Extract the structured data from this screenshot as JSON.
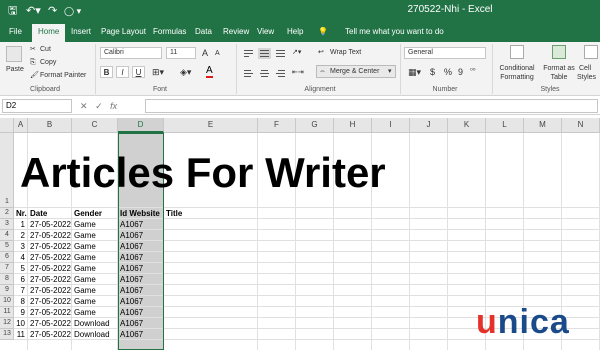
{
  "window": {
    "doc_title": "270522-Nhi  -  Excel"
  },
  "quick_access": {
    "save_icon": "save-icon",
    "undo_icon": "undo-icon",
    "redo_icon": "redo-icon"
  },
  "tabs": [
    "File",
    "Home",
    "Insert",
    "Page Layout",
    "Formulas",
    "Data",
    "Review",
    "View",
    "Help"
  ],
  "tell_me": "Tell me what you want to do",
  "ribbon": {
    "clipboard": {
      "paste": "Paste",
      "cut": "Cut",
      "copy": "Copy",
      "format_painter": "Format Painter",
      "label": "Clipboard"
    },
    "font": {
      "name": "Calibri",
      "size": "11",
      "grow": "A",
      "shrink": "A",
      "bold": "B",
      "italic": "I",
      "underline": "U",
      "font_color": "A",
      "label": "Font"
    },
    "alignment": {
      "wrap_text": "Wrap Text",
      "merge_center": "Merge & Center",
      "label": "Alignment"
    },
    "number": {
      "format": "General",
      "currency": "$",
      "percent": "%",
      "comma": "9",
      "label": "Number"
    },
    "styles": {
      "conditional_formatting": [
        "Conditional",
        "Formatting"
      ],
      "format_as_table": [
        "Format as",
        "Table"
      ],
      "cell_styles": [
        "Cell",
        "Styles"
      ],
      "label": "Styles"
    }
  },
  "formula_bar": {
    "name_box": "D2",
    "cancel": "✕",
    "enter": "✓",
    "fx": "fx",
    "value": ""
  },
  "columns": [
    "A",
    "B",
    "C",
    "D",
    "E",
    "F",
    "G",
    "H",
    "I",
    "J",
    "K",
    "L",
    "M",
    "N"
  ],
  "selected_column": "D",
  "rows": [
    "1",
    "2",
    "3",
    "4",
    "5",
    "6",
    "7",
    "8",
    "9",
    "10",
    "11",
    "12",
    "13"
  ],
  "sheet": {
    "title": "Articles For Writer",
    "headers": [
      "Nr.",
      "Date",
      "Gender",
      "Id Website",
      "Title"
    ],
    "data": [
      [
        "1",
        "27-05-2022",
        "Game",
        "A1067"
      ],
      [
        "2",
        "27-05-2022",
        "Game",
        "A1067"
      ],
      [
        "3",
        "27-05-2022",
        "Game",
        "A1067"
      ],
      [
        "4",
        "27-05-2022",
        "Game",
        "A1067"
      ],
      [
        "5",
        "27-05-2022",
        "Game",
        "A1067"
      ],
      [
        "6",
        "27-05-2022",
        "Game",
        "A1067"
      ],
      [
        "7",
        "27-05-2022",
        "Game",
        "A1067"
      ],
      [
        "8",
        "27-05-2022",
        "Game",
        "A1067"
      ],
      [
        "9",
        "27-05-2022",
        "Game",
        "A1067"
      ],
      [
        "10",
        "27-05-2022",
        "Download",
        "A1067"
      ],
      [
        "11",
        "27-05-2022",
        "Download",
        "A1067"
      ]
    ]
  },
  "watermark": {
    "text_u": "u",
    "text_rest": "nica",
    "color_red": "#e4322b",
    "color_blue": "#1a4a8a"
  },
  "colors": {
    "excel_green": "#217346"
  }
}
